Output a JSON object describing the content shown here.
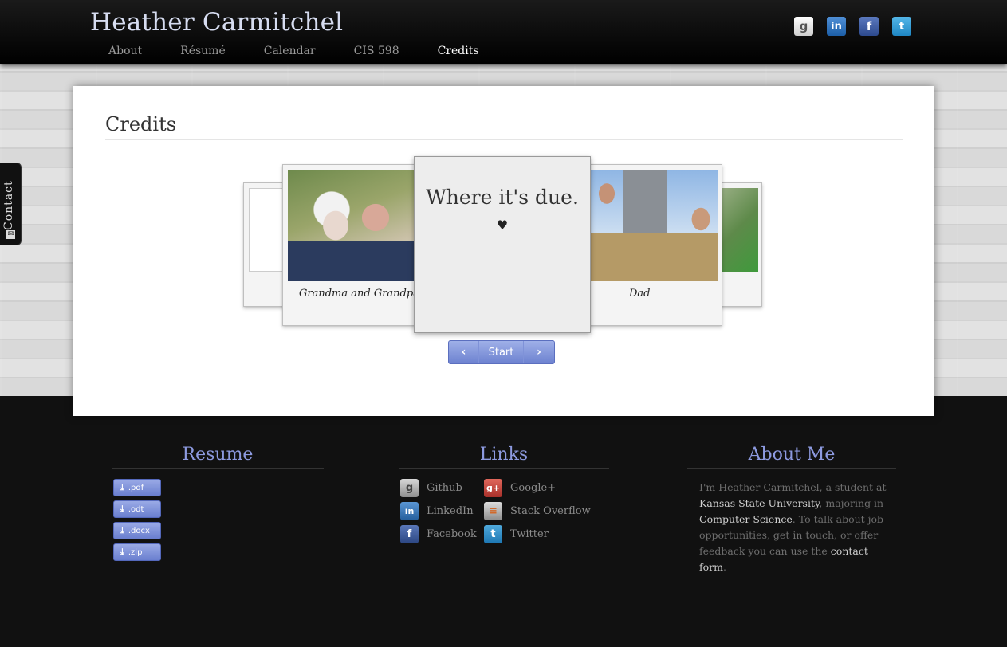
{
  "header": {
    "site_title": "Heather Carmitchel",
    "nav": [
      {
        "label": "About"
      },
      {
        "label": "Résumé"
      },
      {
        "label": "Calendar"
      },
      {
        "label": "CIS 598"
      },
      {
        "label": "Credits"
      }
    ],
    "active_nav": "Credits",
    "social_icons": [
      "github-icon",
      "linkedin-icon",
      "facebook-icon",
      "twitter-icon"
    ]
  },
  "contact_tab": {
    "label": "Contact"
  },
  "main": {
    "title": "Credits",
    "carousel": {
      "center_title": "Where it's due.",
      "center_symbol": "♥",
      "left_caption": "Grandma and Grandpa",
      "right_caption": "Dad",
      "controls": {
        "prev": "‹",
        "start": "Start",
        "next": "›"
      }
    }
  },
  "footer": {
    "resume": {
      "heading": "Resume",
      "downloads": [
        {
          "label": ".pdf"
        },
        {
          "label": ".odt"
        },
        {
          "label": ".docx"
        },
        {
          "label": ".zip"
        }
      ]
    },
    "links": {
      "heading": "Links",
      "items": [
        {
          "label": "Github",
          "glyph": "g"
        },
        {
          "label": "Google+",
          "glyph": "g+"
        },
        {
          "label": "LinkedIn",
          "glyph": "in"
        },
        {
          "label": "Stack Overflow",
          "glyph": "≡"
        },
        {
          "label": "Facebook",
          "glyph": "f"
        },
        {
          "label": "Twitter",
          "glyph": "t"
        }
      ]
    },
    "about": {
      "heading": "About Me",
      "text_1": "I'm Heather Carmitchel, a student at ",
      "link_1": "Kansas State University",
      "text_2": ", majoring in ",
      "link_2": "Computer Science",
      "text_3": ". To talk about job opportunities, get in touch, or offer feedback you can use the ",
      "link_3": "contact form",
      "text_4": "."
    }
  },
  "colors": {
    "accent": "#8d9ae0",
    "button": "#7a8ed6",
    "header_bg": "#000000",
    "footer_bg": "#111111"
  }
}
